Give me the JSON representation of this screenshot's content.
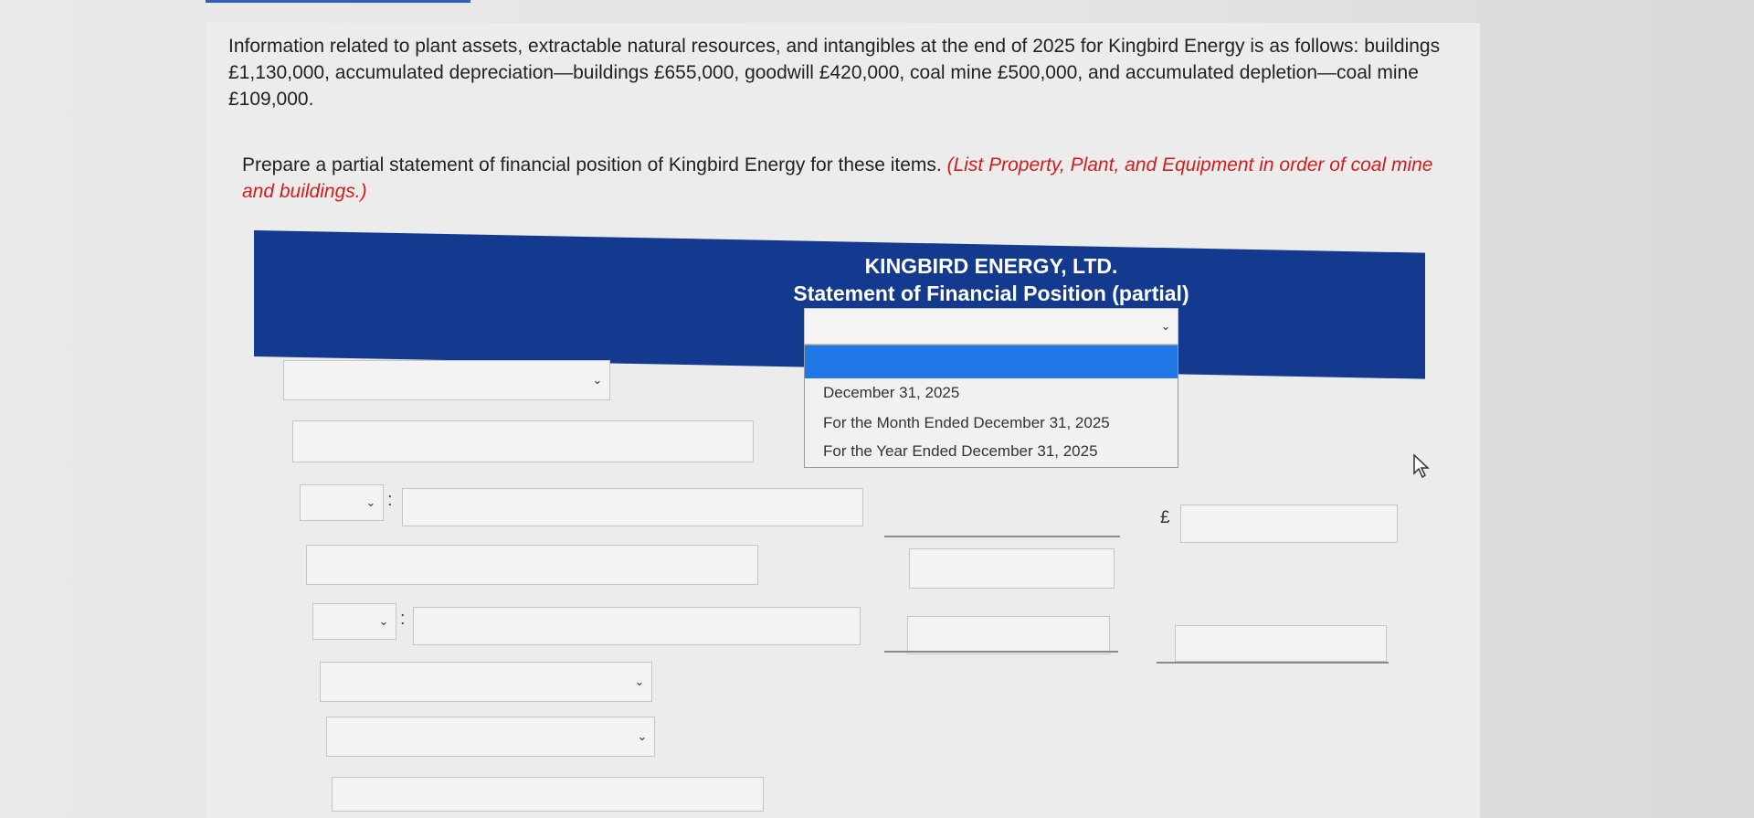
{
  "intro": "Information related to plant assets, extractable natural resources, and intangibles at the end of 2025 for Kingbird Energy is as follows: buildings £1,130,000, accumulated depreciation—buildings £655,000, goodwill £420,000, coal mine £500,000, and accumulated depletion—coal mine £109,000.",
  "question": {
    "text": "Prepare a partial statement of financial position of Kingbird Energy for these items.",
    "instruction": "(List Property, Plant, and Equipment in order of coal mine and buildings.)"
  },
  "statement": {
    "company": "KINGBIRD ENERGY, LTD.",
    "title": "Statement of Financial Position (partial)"
  },
  "date_dropdown": {
    "selected": "",
    "options": [
      "December 31, 2025",
      "For the Month Ended December 31, 2025",
      "For the Year Ended December 31, 2025"
    ]
  },
  "symbols": {
    "colon": ":",
    "pound": "£"
  },
  "icons": {
    "chevron": "chevron-down-icon",
    "cursor": "mouse-pointer-icon"
  }
}
